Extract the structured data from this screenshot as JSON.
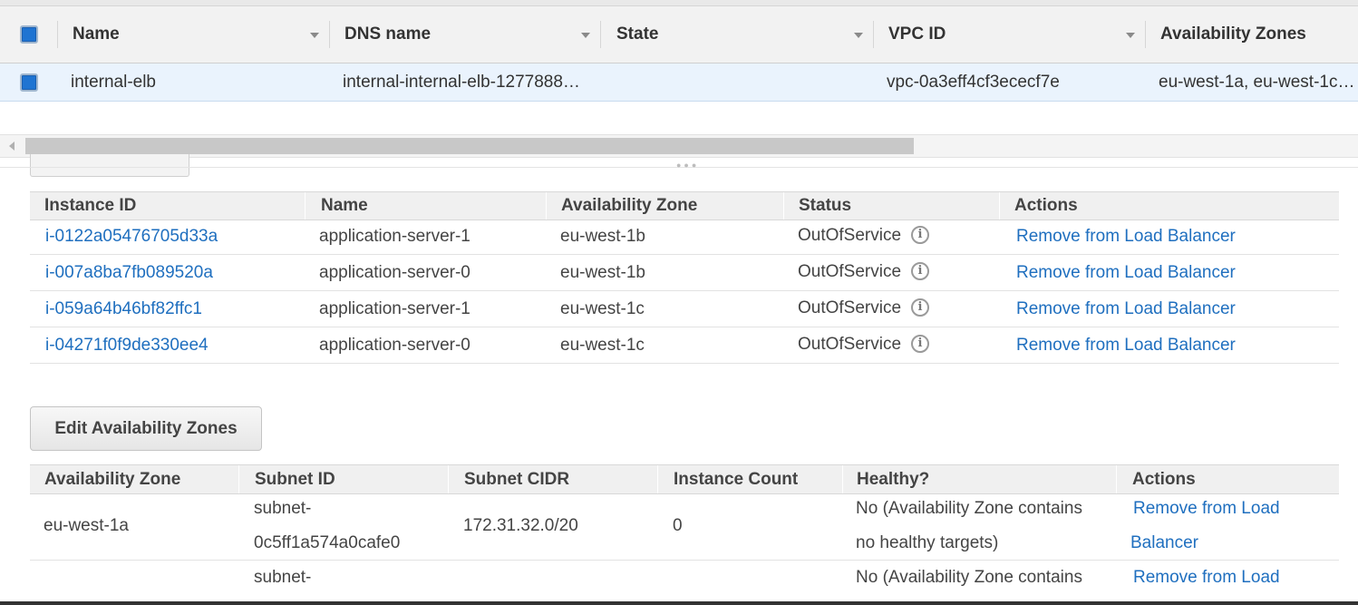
{
  "lb_grid": {
    "columns": [
      "Name",
      "DNS name",
      "State",
      "VPC ID",
      "Availability Zones"
    ],
    "row": {
      "name": "internal-elb",
      "dns_name": "internal-internal-elb-1277888…",
      "state": "",
      "vpc_id": "vpc-0a3eff4cf3ececf7e",
      "availability_zones": "eu-west-1a, eu-west-1c…"
    },
    "horizontal_scroll_fraction": 0.67
  },
  "instances": {
    "columns": [
      "Instance ID",
      "Name",
      "Availability Zone",
      "Status",
      "Actions"
    ],
    "rows": [
      {
        "id": "i-0122a05476705d33a",
        "name": "application-server-1",
        "az": "eu-west-1b",
        "status": "OutOfService",
        "action": "Remove from Load Balancer"
      },
      {
        "id": "i-007a8ba7fb089520a",
        "name": "application-server-0",
        "az": "eu-west-1b",
        "status": "OutOfService",
        "action": "Remove from Load Balancer"
      },
      {
        "id": "i-059a64b46bf82ffc1",
        "name": "application-server-1",
        "az": "eu-west-1c",
        "status": "OutOfService",
        "action": "Remove from Load Balancer"
      },
      {
        "id": "i-04271f0f9de330ee4",
        "name": "application-server-0",
        "az": "eu-west-1c",
        "status": "OutOfService",
        "action": "Remove from Load Balancer"
      }
    ]
  },
  "zones": {
    "edit_button": "Edit Availability Zones",
    "columns": [
      "Availability Zone",
      "Subnet ID",
      "Subnet CIDR",
      "Instance Count",
      "Healthy?",
      "Actions"
    ],
    "rows": [
      {
        "az": "eu-west-1a",
        "subnet_1": "subnet-",
        "subnet_2": "0c5ff1a574a0cafe0",
        "cidr": "172.31.32.0/20",
        "count": "0",
        "healthy_1": "No (Availability Zone contains",
        "healthy_2": "no healthy targets)",
        "action_1": "Remove from Load",
        "action_2": "Balancer"
      },
      {
        "subnet_1": "subnet-",
        "healthy_1": "No (Availability Zone contains",
        "action_1": "Remove from Load"
      }
    ]
  },
  "icons": {
    "checkbox": "checkbox-icon",
    "sort": "sort-caret-icon",
    "info": "info-icon",
    "scroll_left": "scroll-left-arrow-icon",
    "grip": "resize-grip-icon"
  },
  "colors": {
    "link": "#1f6fbf",
    "selected_row": "#eaf3fd",
    "checkbox": "#1f74d2",
    "header_bg": "#f0f0f0"
  }
}
